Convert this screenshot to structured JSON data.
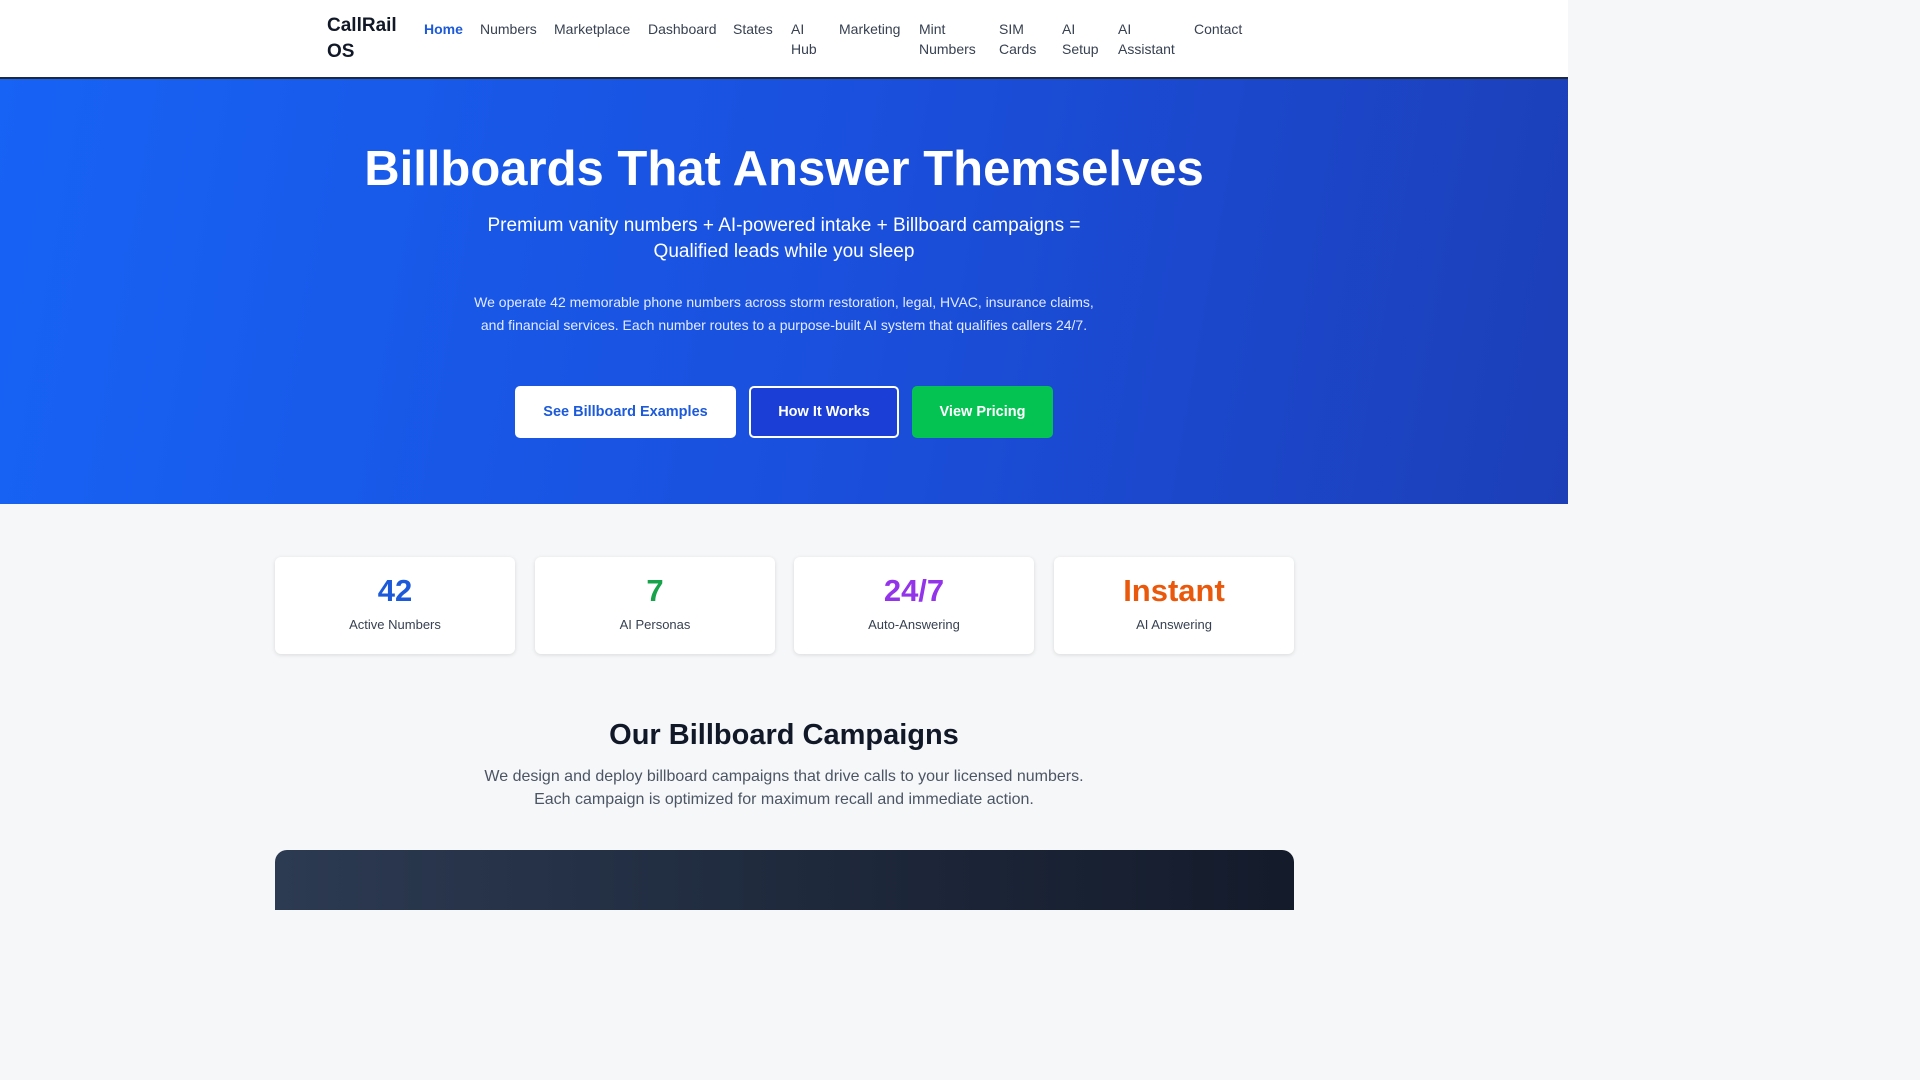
{
  "nav": {
    "brand": "CallRail OS",
    "items": [
      {
        "label": "Home",
        "active": true
      },
      {
        "label": "Numbers",
        "active": false
      },
      {
        "label": "Marketplace",
        "active": false
      },
      {
        "label": "Dashboard",
        "active": false
      },
      {
        "label": "States",
        "active": false
      },
      {
        "label": "AI Hub",
        "active": false
      },
      {
        "label": "Marketing",
        "active": false
      },
      {
        "label": "Mint Numbers",
        "active": false
      },
      {
        "label": "SIM Cards",
        "active": false
      },
      {
        "label": "AI Setup",
        "active": false
      },
      {
        "label": "AI Assistant",
        "active": false
      },
      {
        "label": "Contact",
        "active": false
      }
    ]
  },
  "hero": {
    "title": "Billboards That Answer Themselves",
    "subtitle": "Premium vanity numbers + AI-powered intake + Billboard campaigns = Qualified leads while you sleep",
    "description": "We operate 42 memorable phone numbers across storm restoration, legal, HVAC, insurance claims, and financial services. Each number routes to a purpose-built AI system that qualifies callers 24/7.",
    "buttons": {
      "examples": "See Billboard Examples",
      "how": "How It Works",
      "pricing": "View Pricing"
    }
  },
  "stats": [
    {
      "value": "42",
      "label": "Active Numbers",
      "color": "#1d5ad9"
    },
    {
      "value": "7",
      "label": "AI Personas",
      "color": "#16a34a"
    },
    {
      "value": "24/7",
      "label": "Auto-Answering",
      "color": "#9333ea"
    },
    {
      "value": "Instant",
      "label": "AI Answering",
      "color": "#ea580c"
    }
  ],
  "campaigns": {
    "title": "Our Billboard Campaigns",
    "description": "We design and deploy billboard campaigns that drive calls to your licensed numbers. Each campaign is optimized for maximum recall and immediate action."
  },
  "colors": {
    "primary": "#1d5ad9",
    "hero_start": "#1763f5",
    "hero_end": "#1c3fb8",
    "pricing_button": "#05c353"
  }
}
